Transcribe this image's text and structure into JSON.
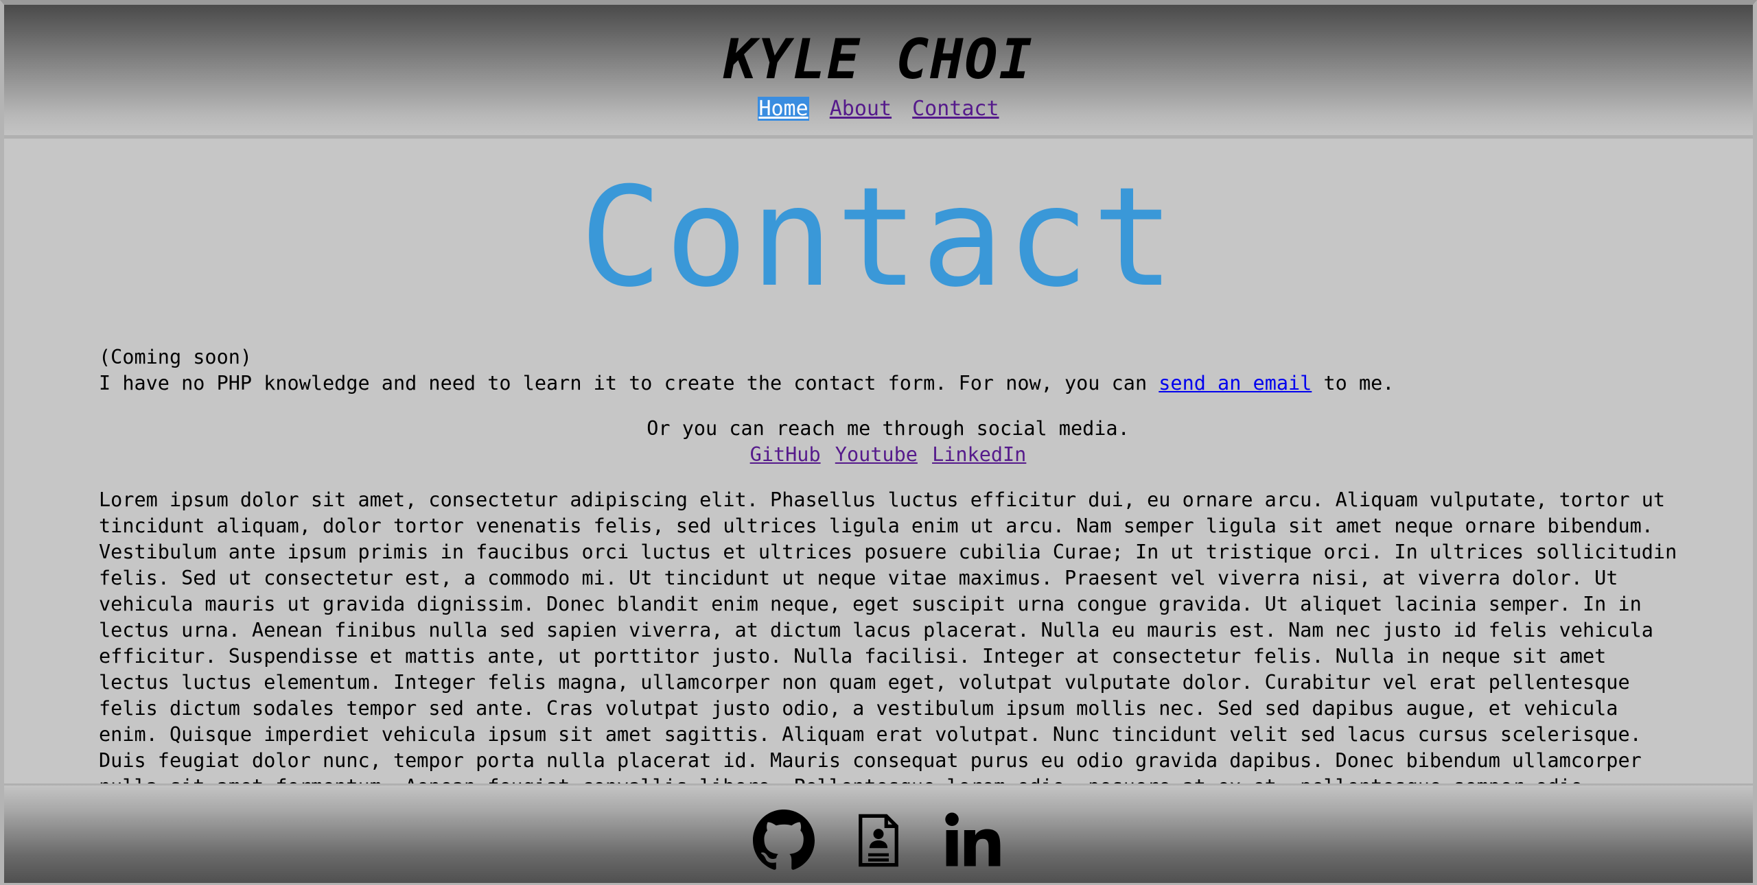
{
  "header": {
    "title": "KYLE CHOI",
    "nav": [
      {
        "label": "Home",
        "active": true
      },
      {
        "label": "About",
        "active": false
      },
      {
        "label": "Contact",
        "active": false
      }
    ]
  },
  "main": {
    "heading": "Contact",
    "coming_soon": "(Coming soon)",
    "intro_before_link": "I have no PHP knowledge and need to learn it to create the contact form. For now, you can ",
    "email_link_label": "send an email",
    "intro_after_link": " to me.",
    "social_text": "Or you can reach me through social media.",
    "social_links": [
      "GitHub",
      "Youtube",
      "LinkedIn"
    ],
    "lorem": "Lorem ipsum dolor sit amet, consectetur adipiscing elit. Phasellus luctus efficitur dui, eu ornare arcu. Aliquam vulputate, tortor ut tincidunt aliquam, dolor tortor venenatis felis, sed ultrices ligula enim ut arcu. Nam semper ligula sit amet neque ornare bibendum. Vestibulum ante ipsum primis in faucibus orci luctus et ultrices posuere cubilia Curae; In ut tristique orci. In ultrices sollicitudin felis. Sed ut consectetur est, a commodo mi. Ut tincidunt ut neque vitae maximus. Praesent vel viverra nisi, at viverra dolor. Ut vehicula mauris ut gravida dignissim. Donec blandit enim neque, eget suscipit urna congue gravida. Ut aliquet lacinia semper. In in lectus urna. Aenean finibus nulla sed sapien viverra, at dictum lacus placerat. Nulla eu mauris est. Nam nec justo id felis vehicula efficitur. Suspendisse et mattis ante, ut porttitor justo. Nulla facilisi. Integer at consectetur felis. Nulla in neque sit amet lectus luctus elementum. Integer felis magna, ullamcorper non quam eget, volutpat vulputate dolor. Curabitur vel erat pellentesque felis dictum sodales tempor sed ante. Cras volutpat justo odio, a vestibulum ipsum mollis nec. Sed sed dapibus augue, et vehicula enim. Quisque imperdiet vehicula ipsum sit amet sagittis. Aliquam erat volutpat. Nunc tincidunt velit sed lacus cursus scelerisque. Duis feugiat dolor nunc, tempor porta nulla placerat id. Mauris consequat purus eu odio gravida dapibus. Donec bibendum ullamcorper nulla sit amet fermentum. Aenean feugiat convallis libero. Pellentesque lorem odio, posuere at ex et, pellentesque semper odio. Suspendisse potenti."
  },
  "footer": {
    "icons": [
      "github-icon",
      "resume-icon",
      "linkedin-icon"
    ]
  },
  "colors": {
    "heading": "#3a98d8",
    "nav_active_bg": "#3a8de0",
    "link_visited": "#551a8b",
    "link": "#0000ee",
    "background": "#c6c6c6"
  }
}
